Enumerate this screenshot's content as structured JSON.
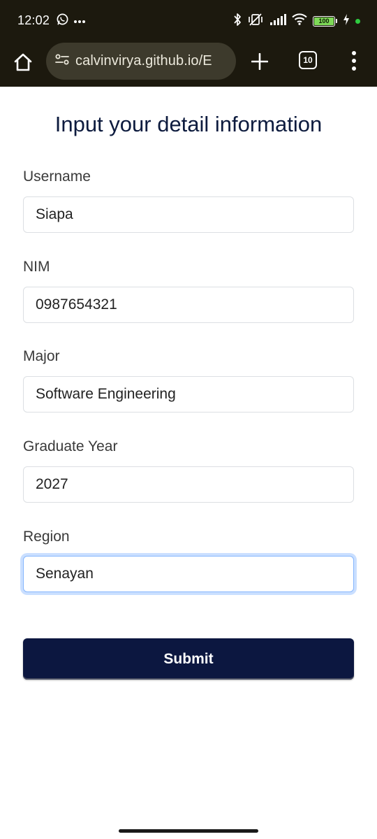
{
  "status_bar": {
    "time": "12:02",
    "battery": "100",
    "icons": [
      "whatsapp-icon",
      "more-notifications-icon",
      "bluetooth-icon",
      "vibrate-off-icon",
      "signal-icon",
      "wifi-icon",
      "battery-icon",
      "charging-icon"
    ]
  },
  "browser": {
    "url": "calvinvirya.github.io/E",
    "tab_count": "10"
  },
  "page": {
    "title": "Input your detail information"
  },
  "form": {
    "fields": [
      {
        "label": "Username",
        "value": "Siapa"
      },
      {
        "label": "NIM",
        "value": "0987654321"
      },
      {
        "label": "Major",
        "value": "Software Engineering"
      },
      {
        "label": "Graduate Year",
        "value": "2027"
      },
      {
        "label": "Region",
        "value": "Senayan"
      }
    ],
    "submit_label": "Submit"
  },
  "colors": {
    "toolbar_bg": "#1c190e",
    "url_pill_bg": "#3d3a2c",
    "title_color": "#0d1b3e",
    "button_bg": "#0c1740",
    "focus_ring": "#86b7fe",
    "battery_fill": "#7ed957"
  }
}
